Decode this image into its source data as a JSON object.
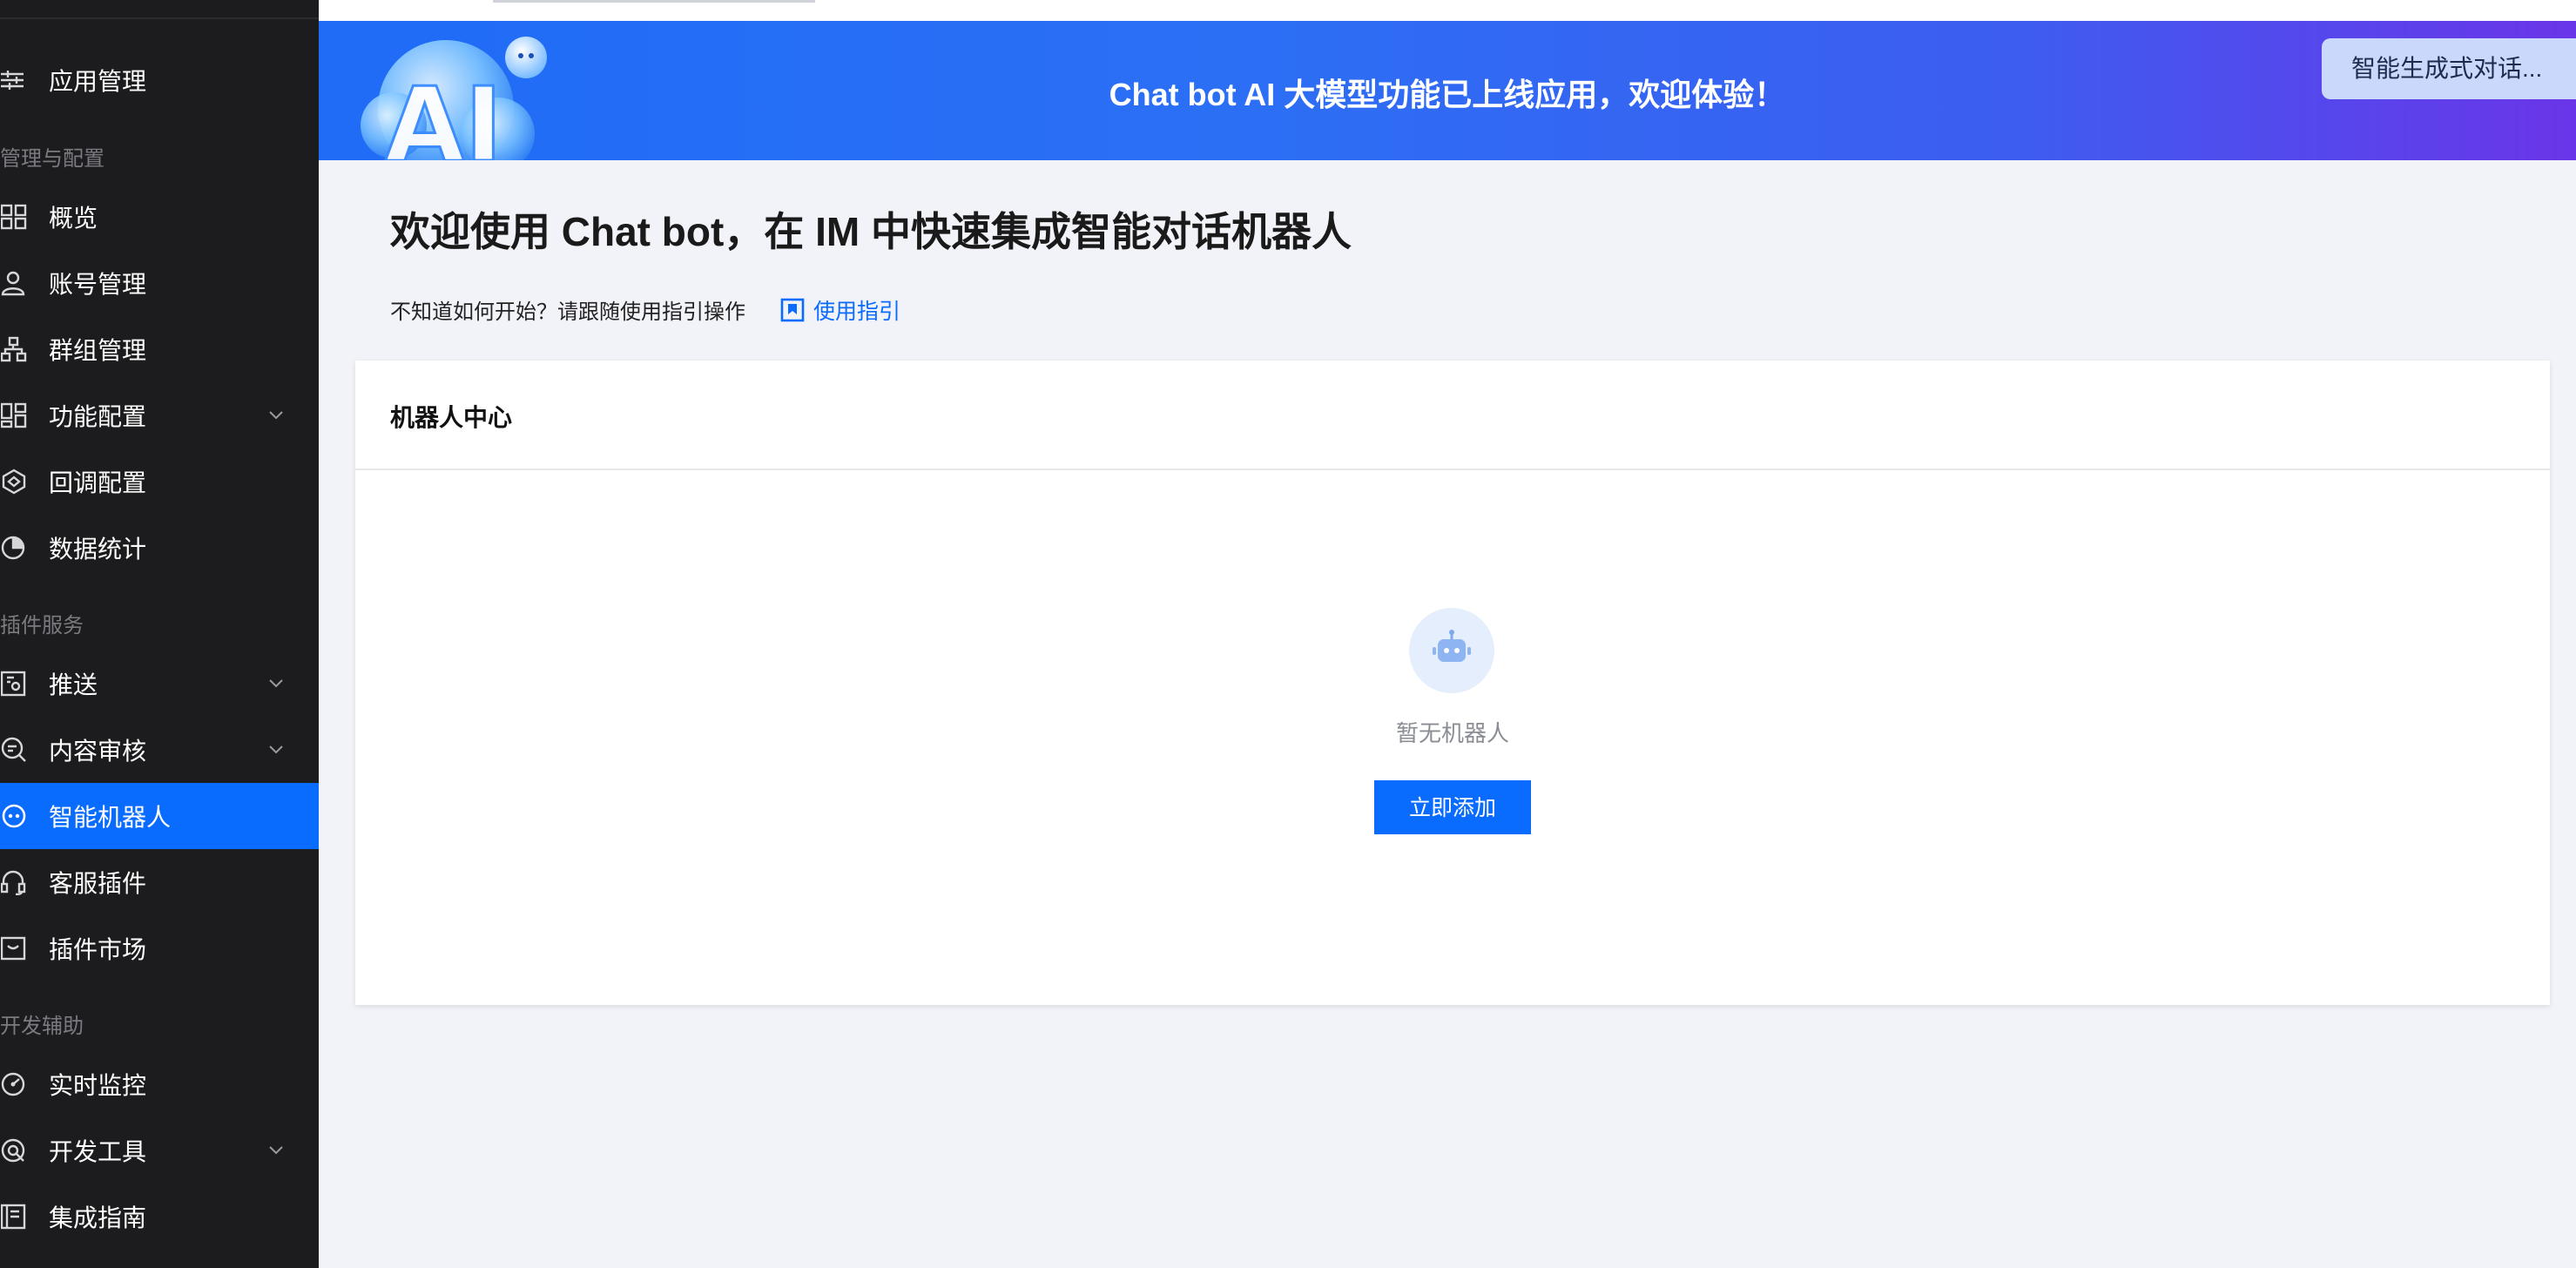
{
  "sidebar": {
    "app_management": "应用管理",
    "groups": {
      "manage_config": "管理与配置",
      "plugin_services": "插件服务",
      "dev_assist": "开发辅助"
    },
    "items": [
      {
        "label": "概览",
        "icon": "grid-icon"
      },
      {
        "label": "账号管理",
        "icon": "user-icon"
      },
      {
        "label": "群组管理",
        "icon": "org-icon"
      },
      {
        "label": "功能配置",
        "icon": "layout-icon",
        "expandable": true
      },
      {
        "label": "回调配置",
        "icon": "callback-icon"
      },
      {
        "label": "数据统计",
        "icon": "pie-icon"
      },
      {
        "label": "推送",
        "icon": "push-icon",
        "expandable": true
      },
      {
        "label": "内容审核",
        "icon": "audit-icon",
        "expandable": true
      },
      {
        "label": "智能机器人",
        "icon": "bot-icon",
        "active": true
      },
      {
        "label": "客服插件",
        "icon": "headset-icon"
      },
      {
        "label": "插件市场",
        "icon": "store-icon"
      },
      {
        "label": "实时监控",
        "icon": "gauge-icon"
      },
      {
        "label": "开发工具",
        "icon": "tool-icon",
        "expandable": true
      },
      {
        "label": "集成指南",
        "icon": "book-icon"
      }
    ]
  },
  "banner": {
    "text": "Chat bot AI 大模型功能已上线应用，欢迎体验！",
    "chip_label": "智能生成式对话...",
    "art_text": "AI"
  },
  "main": {
    "title": "欢迎使用 Chat bot，在 IM 中快速集成智能对话机器人",
    "hint": "不知道如何开始？请跟随使用指引操作",
    "guide_link": "使用指引"
  },
  "card": {
    "title": "机器人中心",
    "empty_text": "暂无机器人",
    "add_button": "立即添加"
  },
  "colors": {
    "sidebar_bg": "#1c1c1e",
    "accent": "#0a6cff",
    "page_bg": "#f2f3f8"
  }
}
